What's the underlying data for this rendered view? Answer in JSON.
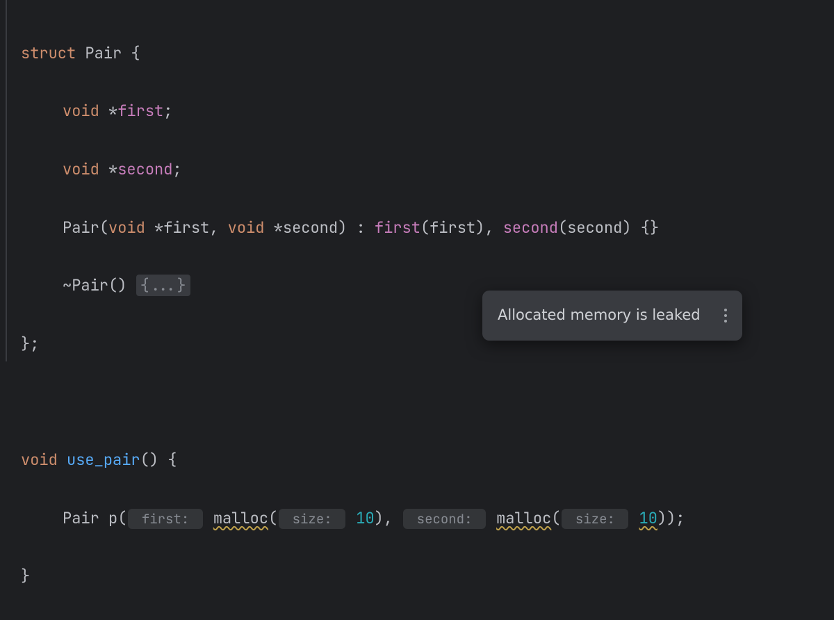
{
  "code": {
    "l1": {
      "struct": "struct",
      "name": "Pair",
      "brace": " {"
    },
    "l2": {
      "void": "void",
      "star": " *",
      "ident": "first",
      "semi": ";"
    },
    "l3": {
      "void": "void",
      "star": " *",
      "ident": "second",
      "semi": ";"
    },
    "l4": {
      "ctor": "Pair",
      "open": "(",
      "void1": "void",
      "star1": " *",
      "p1": "first",
      "comma1": ", ",
      "void2": "void",
      "star2": " *",
      "p2": "second",
      "close": ")",
      "colon": " : ",
      "m1": "first",
      "po1": "(",
      "a1": "first",
      "pc1": "), ",
      "m2": "second",
      "po2": "(",
      "a2": "second",
      "pc2": ") ",
      "body": "{}"
    },
    "l5": {
      "tilde": "~",
      "ctor": "Pair",
      "parens": "() ",
      "fold": "{...}"
    },
    "l6": {
      "close": "};"
    },
    "l8": {
      "void": "void",
      "name": "use_pair",
      "rest": "() {"
    },
    "l9": {
      "type": "Pair",
      "var": " p",
      "open": "(",
      "hint1": " first: ",
      "malloc1": "malloc",
      "mo1": "(",
      "hint1b": " size: ",
      "n1": "10",
      "mc1": "), ",
      "hint2": " second: ",
      "malloc2": "malloc",
      "mo2": "(",
      "hint2b": " size: ",
      "n2": "10",
      "mc2": "));"
    },
    "l10": {
      "close": "}"
    }
  },
  "tooltip": {
    "text": "Allocated memory is leaked"
  }
}
